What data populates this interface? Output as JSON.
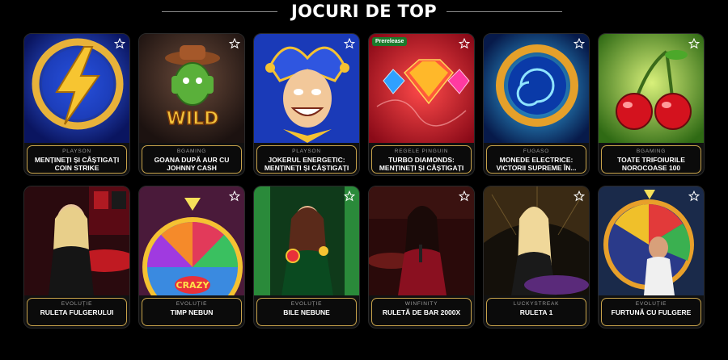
{
  "page": {
    "section_title": "JOCURI DE TOP"
  },
  "colors": {
    "gold_border": "#c9a44b",
    "background": "#000000",
    "badge_green": "#1c7a2c"
  },
  "games": [
    {
      "provider": "PLAYSON",
      "name": "MENȚINEȚI ȘI CÂȘTIGAȚI COIN STRIKE",
      "icon": "lightning-coin-art"
    },
    {
      "provider": "BGAMING",
      "name": "GOANA DUPĂ AUR CU JOHNNY CASH",
      "icon": "cactus-cowboy-wild-art"
    },
    {
      "provider": "PLAYSON",
      "name": "JOKERUL ENERGETIC: MENȚINEȚI ȘI CÂȘTIGAȚI",
      "icon": "joker-art"
    },
    {
      "provider": "REGELE PINGUIN",
      "name": "TURBO DIAMONDS: MENȚINEȚI ȘI CÂȘTIGAȚI",
      "icon": "diamond-art",
      "badge": "Prerelease"
    },
    {
      "provider": "FUGASO",
      "name": "MONEDE ELECTRICE: VICTORII SUPREME ÎN...",
      "icon": "electric-coin-art"
    },
    {
      "provider": "BGAMING",
      "name": "TOATE TRIFOIURILE NOROCOASE 100",
      "icon": "cherries-art"
    },
    {
      "provider": "EVOLUȚIE",
      "name": "RULETA FULGERULUI",
      "icon": "lightning-roulette-host-art"
    },
    {
      "provider": "EVOLUȚIE",
      "name": "TIMP NEBUN",
      "icon": "crazy-time-wheel-art"
    },
    {
      "provider": "EVOLUȚIE",
      "name": "BILE NEBUNE",
      "icon": "crazy-balls-host-art"
    },
    {
      "provider": "WINFINITY",
      "name": "RULETĂ DE BAR 2000X",
      "icon": "bar-roulette-host-art"
    },
    {
      "provider": "LUCKYSTREAK",
      "name": "RULETA 1",
      "icon": "roulette-host-art"
    },
    {
      "provider": "EVOLUȚIE",
      "name": "FURTUNĂ CU FULGERE",
      "icon": "lightning-storm-wheel-art"
    }
  ]
}
